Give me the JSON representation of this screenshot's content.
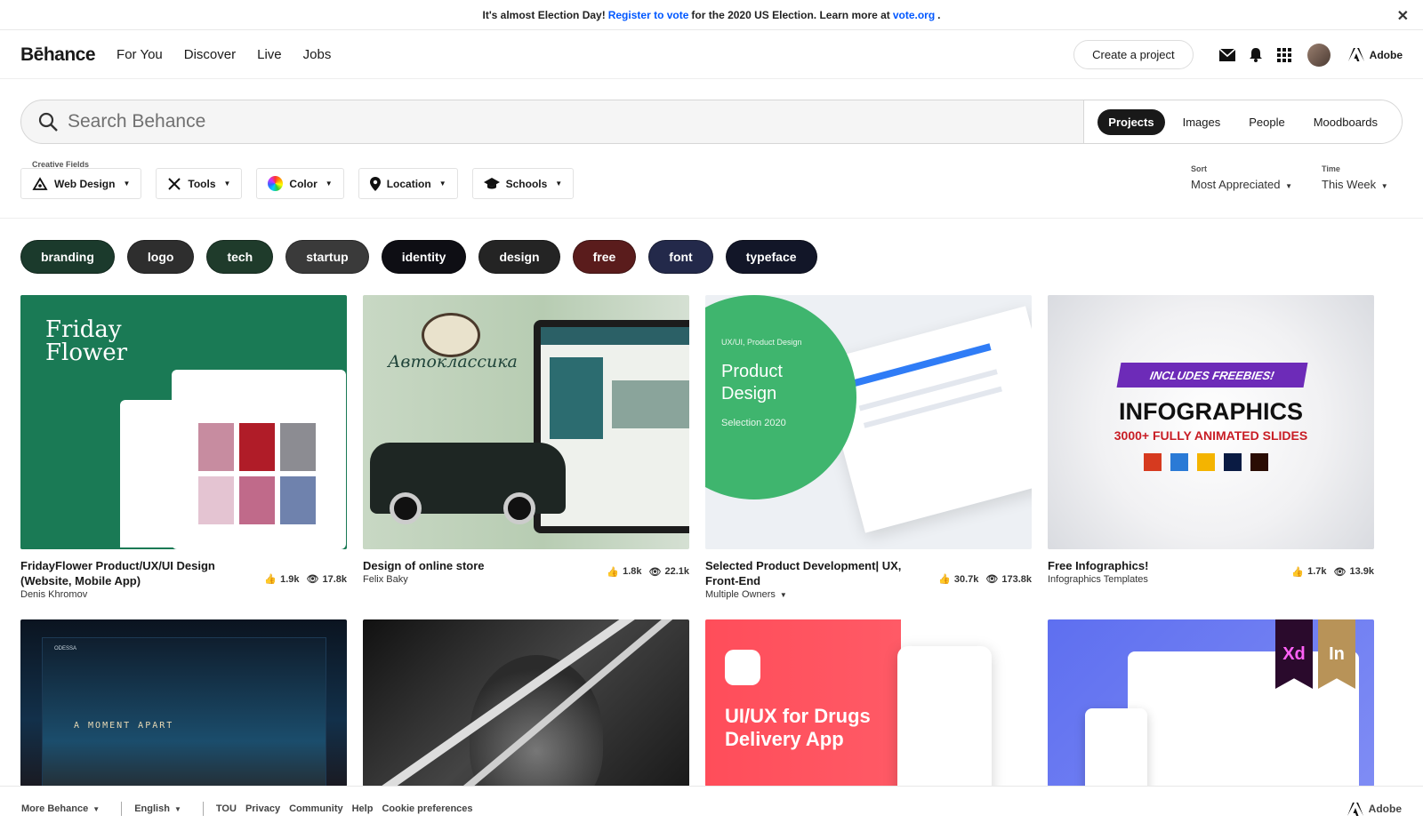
{
  "banner": {
    "prefix": "It's almost Election Day!",
    "link": "Register to vote",
    "middle": "for the 2020 US Election. Learn more at",
    "link2": "vote.org",
    "suffix": "."
  },
  "nav": {
    "logo": "Bēhance",
    "links": [
      "For You",
      "Discover",
      "Live",
      "Jobs"
    ],
    "create": "Create a project",
    "adobe": "Adobe"
  },
  "search": {
    "placeholder": "Search Behance",
    "scopes": [
      "Projects",
      "Images",
      "People",
      "Moodboards"
    ],
    "active_scope": "Projects"
  },
  "filters": {
    "creative_fields_label": "Creative Fields",
    "creative_fields": "Web Design",
    "tools": "Tools",
    "color": "Color",
    "location": "Location",
    "schools": "Schools"
  },
  "sort": {
    "label": "Sort",
    "value": "Most Appreciated"
  },
  "time": {
    "label": "Time",
    "value": "This Week"
  },
  "tags": [
    {
      "label": "branding",
      "color": "#1b3a2c"
    },
    {
      "label": "logo",
      "color": "#2e2e2e"
    },
    {
      "label": "tech",
      "color": "#1f3b2b"
    },
    {
      "label": "startup",
      "color": "#3a3a3a"
    },
    {
      "label": "identity",
      "color": "#0e0e14"
    },
    {
      "label": "design",
      "color": "#242424"
    },
    {
      "label": "free",
      "color": "#5a1c1c"
    },
    {
      "label": "font",
      "color": "#23294a"
    },
    {
      "label": "typeface",
      "color": "#121628"
    }
  ],
  "projects": [
    {
      "title": "FridayFlower Product/UX/UI Design (Website, Mobile App)",
      "owner": "Denis Khromov",
      "likes": "1.9k",
      "views": "17.8k",
      "thumb_text": "Friday Flower"
    },
    {
      "title": "Design of online store",
      "owner": "Felix Baky",
      "likes": "1.8k",
      "views": "22.1k",
      "thumb_text": "Автоклассика"
    },
    {
      "title": "Selected Product Development| UX, Front-End",
      "owner": "Multiple Owners",
      "likes": "30.7k",
      "views": "173.8k",
      "thumb_kicker": "UX/UI, Product Design",
      "thumb_text": "Product Design",
      "thumb_sub": "Selection 2020"
    },
    {
      "title": "Free Infographics!",
      "owner": "Infographics Templates",
      "likes": "1.7k",
      "views": "13.9k",
      "thumb_badge": "INCLUDES FREEBIES!",
      "thumb_text": "INFOGRAPHICS",
      "thumb_sub": "3000+ FULLY ANIMATED SLIDES"
    },
    {
      "thumb_text": "A MOMENT APART",
      "thumb_kicker": "ODESSA"
    },
    {
      "thumb_text": ""
    },
    {
      "thumb_text": "UI/UX for Drugs Delivery App"
    },
    {
      "thumb_badge_xd": "Xd",
      "thumb_badge_in": "In"
    }
  ],
  "footer": {
    "more": "More Behance",
    "language": "English",
    "links": [
      "TOU",
      "Privacy",
      "Community",
      "Help",
      "Cookie preferences"
    ],
    "adobe": "Adobe"
  }
}
